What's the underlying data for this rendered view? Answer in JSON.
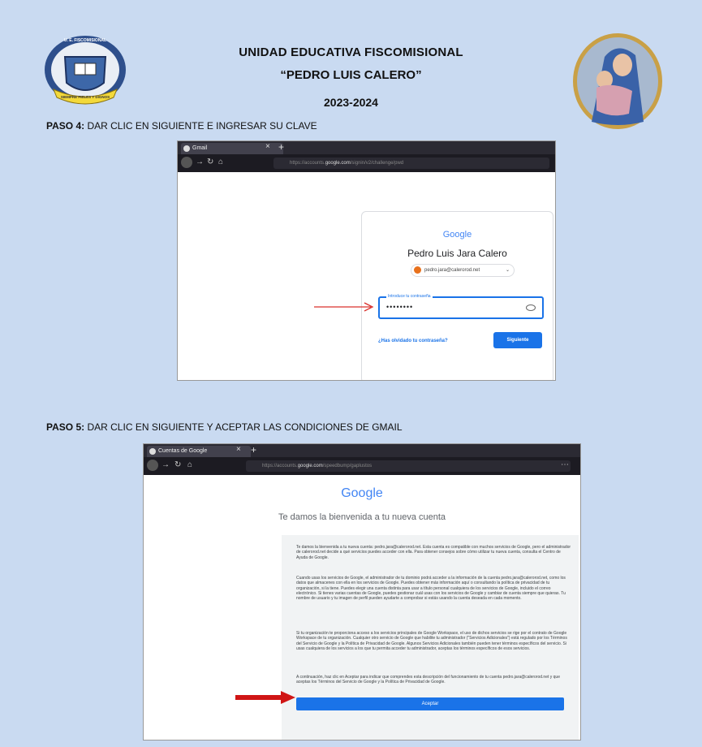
{
  "header": {
    "school_line1": "UNIDAD EDUCATIVA FISCOMISIONAL",
    "school_line2": "“PEDRO LUIS CALERO”",
    "year": "2023-2024",
    "logo_top_text": "U. E. FISCOMISIONAL",
    "logo_banner_text": "SIEMPRE FIELES Y DIGNOS",
    "logo_icon": "school-crest-icon",
    "medal_icon": "virgin-and-child-medallion-icon"
  },
  "step4": {
    "label": "PASO 4:",
    "text": "DAR CLIC EN SIGUIENTE E INGRESAR SU CLAVE",
    "browser": {
      "tab_label": "Gmail",
      "url_domain": "google.com",
      "google_logo": "Google",
      "account_name": "Pedro Luis Jara Calero",
      "account_email": "pedro.jara@calerorod.net",
      "password_label": "Introduce tu contraseña",
      "password_value": "••••••••",
      "forgot_link": "¿Has olvidado tu contraseña?",
      "next_button": "Siguiente"
    },
    "arrow_color": "#d9302c"
  },
  "step5": {
    "label": "PASO 5:",
    "text": "DAR CLIC EN SIGUIENTE Y ACEPTAR LAS CONDICIONES DE GMAIL",
    "browser": {
      "tab_label": "Cuentas de Google",
      "url_domain": "google.com",
      "google_logo": "Google",
      "welcome_title": "Te damos la bienvenida a tu nueva cuenta",
      "paragraphs": [
        "Te damos la bienvenida a tu nueva cuenta: pedro.jara@calerorod.net. Esta cuenta es compatible con muchos servicios de Google, pero el administrador de calerorod.net decide a qué servicios puedes acceder con ella. Para obtener consejos sobre cómo utilizar tu nueva cuenta, consulta el Centro de Ayuda de Google.",
        "Cuando usas los servicios de Google, el administrador de tu dominio podrá acceder a la información de la cuenta pedro.jara@calerorod.net, como los datos que almacenes con ella en los servicios de Google. Puedes obtener más información aquí o consultando la política de privacidad de tu organización, si la tiene. Puedes elegir una cuenta distinta para usar a título personal cualquiera de los servicios de Google, incluido el correo electrónico. Si tienes varias cuentas de Google, puedes gestionar cuál usas con los servicios de Google y cambiar de cuenta siempre que quieras. Tu nombre de usuario y tu imagen de perfil pueden ayudarte a comprobar si estás usando la cuenta deseada en cada momento.",
        "Si tu organización te proporciona acceso a los servicios principales de Google Workspace, el uso de dichos servicios se rige por el contrato de Google Workspace de tu organización. Cualquier otro servicio de Google que habilite tu administrador (\"Servicios Adicionales\") está regulado por los Términos del Servicio de Google y la Política de Privacidad de Google. Algunos Servicios Adicionales también pueden tener términos específicos del servicio. Si usas cualquiera de los servicios a los que tu permita acceder tu administrador, aceptas los términos específicos de esos servicios.",
        "A continuación, haz clic en Aceptar para indicar que comprendes esta descripción del funcionamiento de tu cuenta pedro.jara@calerorod.net y que aceptas los Términos del Servicio de Google y la Política de Privacidad de Google."
      ],
      "accept_button": "Aceptar"
    },
    "arrow_color": "#d01515"
  }
}
